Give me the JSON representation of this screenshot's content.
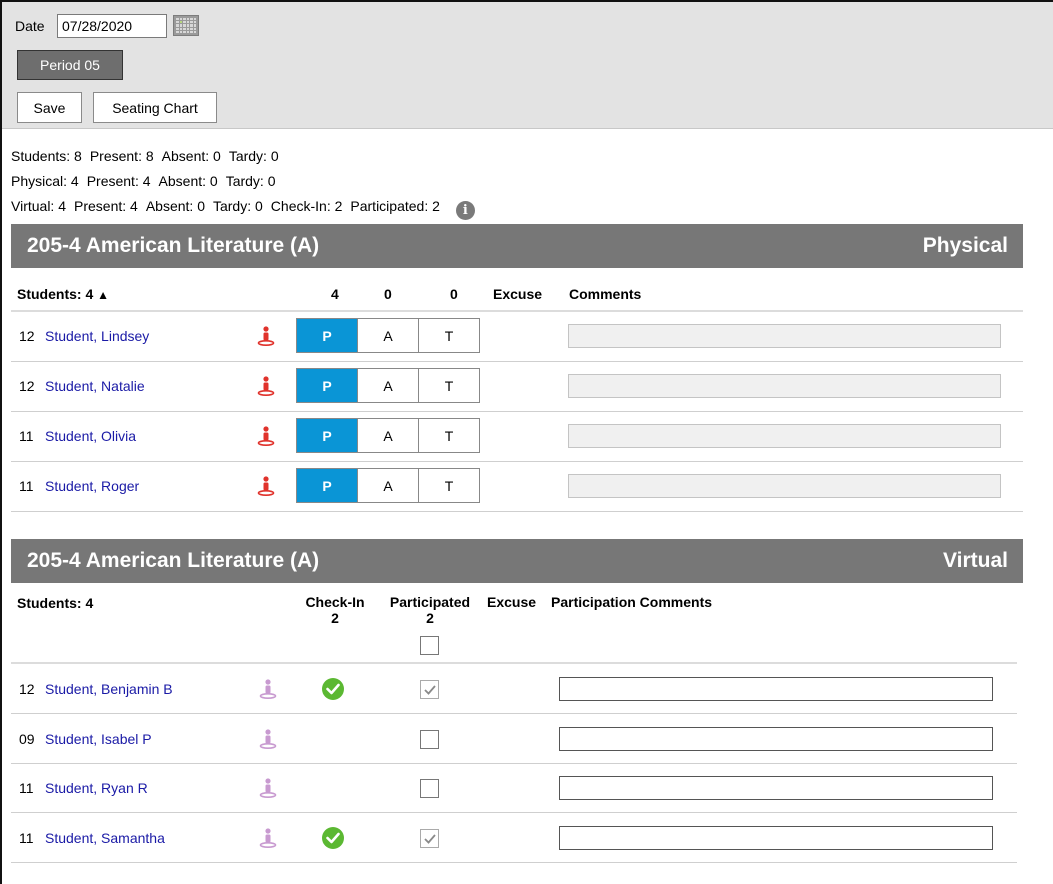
{
  "toolbar": {
    "date_label": "Date",
    "date_value": "07/28/2020",
    "period_label": "Period 05",
    "save_label": "Save",
    "seating_label": "Seating Chart"
  },
  "summary": {
    "students": "Students: 8",
    "students_present": "Present: 8",
    "students_absent": "Absent: 0",
    "students_tardy": "Tardy: 0",
    "physical": "Physical: 4",
    "physical_present": "Present: 4",
    "physical_absent": "Absent: 0",
    "physical_tardy": "Tardy: 0",
    "virtual": "Virtual: 4",
    "virtual_present": "Present: 4",
    "virtual_absent": "Absent: 0",
    "virtual_tardy": "Tardy: 0",
    "virtual_checkin": "Check-In: 2",
    "virtual_participated": "Participated: 2",
    "info_glyph": "i"
  },
  "physical": {
    "title": "205-4 American Literature (A)",
    "mode": "Physical",
    "students_header": "Students: 4",
    "sort_glyph": "▲",
    "count_p": "4",
    "count_a": "0",
    "count_t": "0",
    "excuse_header": "Excuse",
    "comments_header": "Comments",
    "btn_p": "P",
    "btn_a": "A",
    "btn_t": "T",
    "rows": [
      {
        "grade": "12",
        "name": "Student, Lindsey",
        "status": "P"
      },
      {
        "grade": "12",
        "name": "Student, Natalie",
        "status": "P"
      },
      {
        "grade": "11",
        "name": "Student, Olivia",
        "status": "P"
      },
      {
        "grade": "11",
        "name": "Student, Roger",
        "status": "P"
      }
    ]
  },
  "virtual": {
    "title": "205-4 American Literature (A)",
    "mode": "Virtual",
    "students_header": "Students: 4",
    "checkin_header": "Check-In",
    "checkin_count": "2",
    "participated_header": "Participated",
    "participated_count": "2",
    "excuse_header": "Excuse",
    "comments_header": "Participation Comments",
    "rows": [
      {
        "grade": "12",
        "name": "Student, Benjamin B",
        "checked_in": true,
        "participated": true
      },
      {
        "grade": "09",
        "name": "Student, Isabel P",
        "checked_in": false,
        "participated": false
      },
      {
        "grade": "11",
        "name": "Student, Ryan R",
        "checked_in": false,
        "participated": false
      },
      {
        "grade": "11",
        "name": "Student, Samantha",
        "checked_in": true,
        "participated": true
      }
    ]
  },
  "colors": {
    "present_active": "#0a95d6",
    "physical_icon": "#e0322b",
    "virtual_icon": "#c89ad0",
    "checkin_ok": "#5bb832",
    "banner_bg": "#777777",
    "link": "#1a1aa6"
  },
  "icons": {
    "calendar": "calendar-icon",
    "info": "info-icon",
    "physical_person": "person-icon",
    "virtual_person": "person-icon",
    "checkin": "check-circle-icon",
    "checkbox": "checkbox-icon"
  }
}
